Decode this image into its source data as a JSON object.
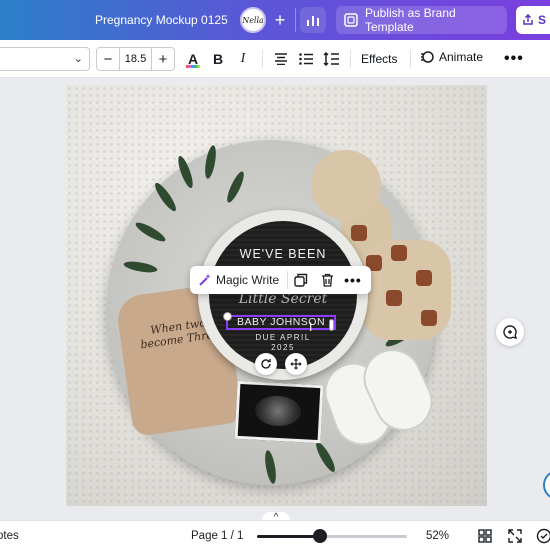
{
  "header": {
    "doc_title": "Pregnancy Mockup 0125",
    "avatar_text": "Nella",
    "plus_label": "+",
    "publish_label": "Publish as Brand Template",
    "share_label": "S"
  },
  "toolbar": {
    "font_size": "18.5",
    "minus_label": "−",
    "plus_label": "+",
    "text_color_label": "A",
    "bold_label": "B",
    "italic_label": "I",
    "effects_label": "Effects",
    "animate_label": "Animate",
    "more_label": "•••"
  },
  "board": {
    "line1": "WE'VE BEEN",
    "line2": "Little Secret",
    "line3": "BABY JOHNSON",
    "line4": "DUE APRIL",
    "line5": "2025"
  },
  "onesie": {
    "text": "When two become Three"
  },
  "context_toolbar": {
    "magic_write_label": "Magic Write",
    "more_label": "•••"
  },
  "footer": {
    "notes_label": "otes",
    "page_indicator": "Page 1 / 1",
    "zoom_value": "52%",
    "zoom_fraction": 0.42,
    "pages_toggle_label": "^"
  },
  "colors": {
    "brand_purple": "#8b3dff",
    "header_gradient_start": "#2b7fc9",
    "header_gradient_end": "#7b3ee0"
  }
}
